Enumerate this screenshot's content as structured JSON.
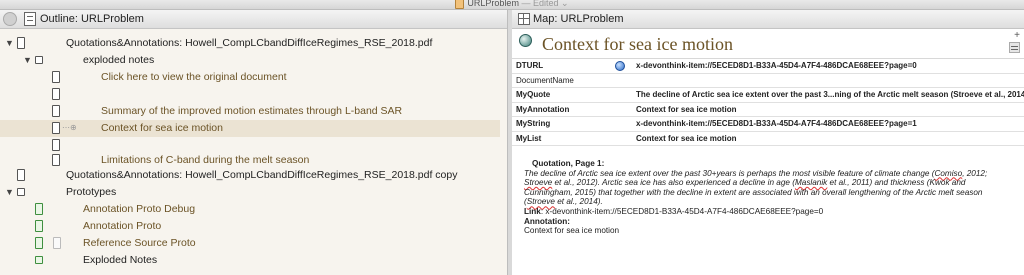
{
  "window": {
    "title": "URLProblem",
    "title_suffix": "— Edited",
    "title_chevron": "⌄"
  },
  "outline": {
    "tab_title": "Outline: URLProblem",
    "rows": [
      {
        "text": "Quotations&Annotations: Howell_CompLCbandDiffIceRegimes_RSE_2018.pdf"
      },
      {
        "text": "exploded notes"
      },
      {
        "text": "Click here to view the original document"
      },
      {
        "text": ""
      },
      {
        "text": "Summary of the improved motion estimates through L-band SAR"
      },
      {
        "text": "Context for sea ice motion"
      },
      {
        "text": ""
      },
      {
        "text": "Limitations of C-band during the melt season"
      },
      {
        "text": "Quotations&Annotations: Howell_CompLCbandDiffIceRegimes_RSE_2018.pdf copy"
      },
      {
        "text": "Prototypes"
      },
      {
        "text": "Annotation Proto Debug"
      },
      {
        "text": "Annotation Proto"
      },
      {
        "text": "Reference Source Proto"
      },
      {
        "text": "Exploded Notes"
      }
    ]
  },
  "map": {
    "tab_title": "Map: URLProblem",
    "plus_label": "+"
  },
  "note": {
    "title": "Context for sea ice motion",
    "attributes": [
      {
        "key": "DTURL",
        "value": "x-devonthink-item://5ECED8D1-B33A-45D4-A7F4-486DCAE68EEE?page=0"
      },
      {
        "key": "DocumentName",
        "value": ""
      },
      {
        "key": "MyQuote",
        "value": "The decline of Arctic sea ice extent over the past 3...ning of the Arctic melt season (Stroeve et al., 2014)."
      },
      {
        "key": "MyAnnotation",
        "value": "Context for sea ice motion"
      },
      {
        "key": "MyString",
        "value": "x-devonthink-item://5ECED8D1-B33A-45D4-A7F4-486DCAE68EEE?page=1"
      },
      {
        "key": "MyList",
        "value": "Context for sea ice motion"
      }
    ],
    "text": {
      "quotation_label": "Quotation, Page 1:",
      "quote_a": "The decline of Arctic sea ice extent over the past 30+years is perhaps the most visible feature of climate change (",
      "quote_comiso": "Comiso",
      "quote_b": ", 2012; ",
      "quote_stroeve": "Stroeve",
      "quote_c": " et al., 2012). Arctic sea ice has also experienced a decline in age (",
      "quote_maslanik": "Maslanik",
      "quote_d": " et al., 2011) and thickness (Kwok and Cunningham, 2015) that together with the decline in extent are associated with an overall lengthening of the Arctic melt season (",
      "quote_stroeve2": "Stroeve",
      "quote_e": " et al., 2014).",
      "link_label": "Link",
      "link_value": ": x-devonthink-item://5ECED8D1-B33A-45D4-A7F4-486DCAE68EEE?page=0",
      "annotation_label": "Annotation:",
      "annotation_value": "Context for sea ice motion"
    }
  }
}
